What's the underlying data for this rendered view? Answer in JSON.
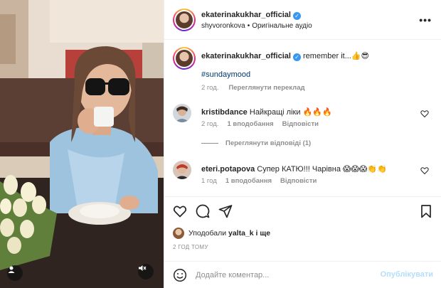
{
  "post": {
    "author": "ekaterinakukhar_official",
    "music_user": "shyvoronkova",
    "music_separator": "•",
    "music_label": "Оригінальне аудіо",
    "more_icon": "more-horizontal-icon"
  },
  "caption": {
    "author": "ekaterinakukhar_official",
    "text": "remember it...👍😎",
    "hashtag": "#sundaymood",
    "time": "2 год.",
    "translate_label": "Переглянути переклад"
  },
  "comments": [
    {
      "user": "kristibdance",
      "text": "Найкращі ліки 🔥🔥🔥",
      "time": "2 год.",
      "likes": "1 вподобання",
      "reply_label": "Відповісти"
    },
    {
      "user": "eteri.potapova",
      "text": "Супер КАТЮ!!! Чарівна 😱😱😱👏👏",
      "time": "1 год",
      "likes": "1 вподобання",
      "reply_label": "Відповісти"
    }
  ],
  "view_replies_label": "Переглянути відповіді (1)",
  "likes": {
    "prefix": "Уподобали",
    "user": "yalta_k",
    "suffix": "і ще"
  },
  "timestamp": "2 ГОД ТОМУ",
  "add_comment": {
    "placeholder": "Додайте коментар...",
    "post_label": "Опублікувати"
  },
  "colors": {
    "link": "#00376b",
    "verified": "#3897f0",
    "post_button_disabled": "#b2dffc",
    "secondary_text": "#8e8e8e"
  }
}
